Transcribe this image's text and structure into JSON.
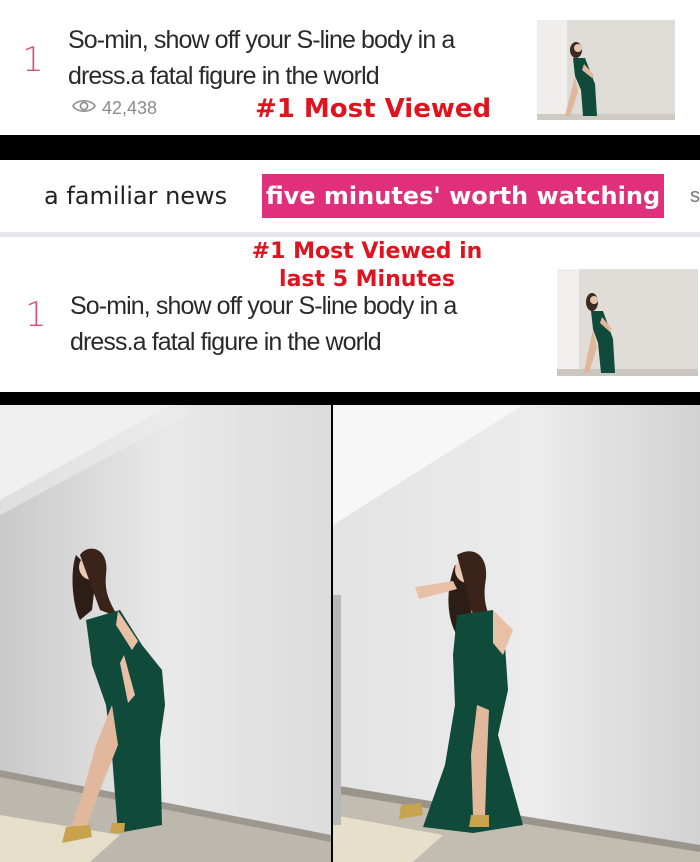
{
  "top_card": {
    "rank": "1",
    "headline_line1": "So-min, show off your S-line body in a",
    "headline_line2": "dress.a fatal figure in the world",
    "views": "42,438",
    "badge": "#1 Most Viewed"
  },
  "tabs": {
    "items": [
      "a familiar news",
      "five minutes' worth watching"
    ],
    "active": "five minutes' worth watching",
    "active_color": "#e0307b"
  },
  "second_card": {
    "badge_line1": "#1 Most Viewed in",
    "badge_line2": "last 5 Minutes",
    "rank": "1",
    "headline_line1": "So-min, show off your S-line body in a",
    "headline_line2": "dress.a fatal figure in the world"
  },
  "colors": {
    "rank": "#d94f78",
    "badge": "#e0131f",
    "dress": "#0f4a3a"
  },
  "icons": [
    "eye-icon"
  ]
}
